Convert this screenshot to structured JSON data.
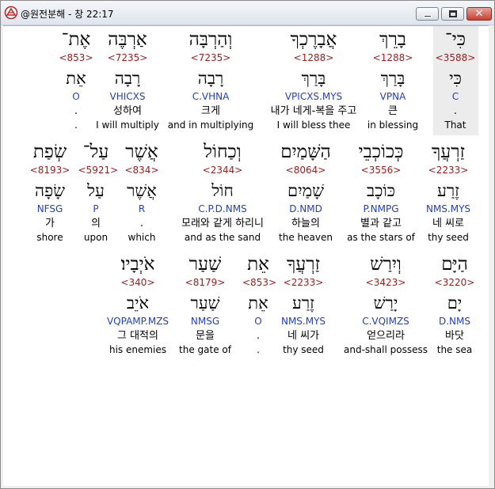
{
  "window": {
    "title": "@원전분해 - 창 22:17",
    "close_glyph": "✕"
  },
  "rows": [
    {
      "words": [
        {
          "hebrew": "כִּי־",
          "strong": "<3588>",
          "lemma": "כִּי",
          "morph": "C",
          "korean": ".",
          "english": "That",
          "highlight": true
        },
        {
          "hebrew": "בָרֵךְ",
          "strong": "<1288>",
          "lemma": "בָּרַךְ",
          "morph": "VPNA",
          "korean": "큰",
          "english": "in blessing"
        },
        {
          "hebrew": "אֲבָרֶכְךָ",
          "strong": "<1288>",
          "lemma": "בָּרַךְ",
          "morph": "VPICXS.MYS",
          "korean": "내가 네게-복을 주고",
          "english": "I will bless thee"
        },
        {
          "hebrew": "וְהַרְבָּה",
          "strong": "<7235>",
          "lemma": "רָבָה",
          "morph": "C.VHNA",
          "korean": "크게",
          "english": "and in multiplying"
        },
        {
          "hebrew": "אַרְבֶּה",
          "strong": "<7235>",
          "lemma": "רָבָה",
          "morph": "VHICXS",
          "korean": "성하여",
          "english": "I will multiply"
        },
        {
          "hebrew": "אֶת־",
          "strong": "<853>",
          "lemma": "אֵת",
          "morph": "O",
          "korean": ".",
          "english": "."
        }
      ]
    },
    {
      "words": [
        {
          "hebrew": "זַרְעֲךָ",
          "strong": "<2233>",
          "lemma": "זֶרַע",
          "morph": "NMS.MYS",
          "korean": "네 씨로",
          "english": "thy seed"
        },
        {
          "hebrew": "כְּכוֹכְבֵי",
          "strong": "<3556>",
          "lemma": "כּוֹכָב",
          "morph": "P.NMPG",
          "korean": "별과 같고",
          "english": "as the stars of"
        },
        {
          "hebrew": "הַשָּׁמַיִם",
          "strong": "<8064>",
          "lemma": "שָׁמַיִם",
          "morph": "D.NMD",
          "korean": "하늘의",
          "english": "the heaven"
        },
        {
          "hebrew": "וְכַחוֹל",
          "strong": "<2344>",
          "lemma": "חוֹל",
          "morph": "C.P.D.NMS",
          "korean": "모래와 같게 하리니",
          "english": "and as the sand"
        },
        {
          "hebrew": "אֲשֶׁר",
          "strong": "<834>",
          "lemma": "אֲשֶׁר",
          "morph": "R",
          "korean": ".",
          "english": "which"
        },
        {
          "hebrew": "עַל־",
          "strong": "<5921>",
          "lemma": "עַל",
          "morph": "P",
          "korean": "의",
          "english": "upon"
        },
        {
          "hebrew": "שְׂפַת",
          "strong": "<8193>",
          "lemma": "שָׂפָה",
          "morph": "NFSG",
          "korean": "가",
          "english": "shore"
        }
      ]
    },
    {
      "words": [
        {
          "hebrew": "הַיָּם",
          "strong": "<3220>",
          "lemma": "יָם",
          "morph": "D.NMS",
          "korean": "바닷",
          "english": "the sea"
        },
        {
          "hebrew": "וְיִרַשׁ",
          "strong": "<3423>",
          "lemma": "יָרַשׁ",
          "morph": "C.VQIMZS",
          "korean": "얻으리라",
          "english": "and-shall possess"
        },
        {
          "hebrew": "זַרְעֲךָ",
          "strong": "<2233>",
          "lemma": "זֶרַע",
          "morph": "NMS.MYS",
          "korean": "네 씨가",
          "english": "thy seed"
        },
        {
          "hebrew": "אֵת",
          "strong": "<853>",
          "lemma": "אֵת",
          "morph": "O",
          "korean": ".",
          "english": "."
        },
        {
          "hebrew": "שַׁעַר",
          "strong": "<8179>",
          "lemma": "שַׁעַר",
          "morph": "NMSG",
          "korean": "문을",
          "english": "the gate of"
        },
        {
          "hebrew": "אֹיְבָיו׃",
          "strong": "<340>",
          "lemma": "אֹיֵב",
          "morph": "VQPAMP.MZS",
          "korean": "그 대적의",
          "english": "his enemies"
        }
      ]
    }
  ]
}
